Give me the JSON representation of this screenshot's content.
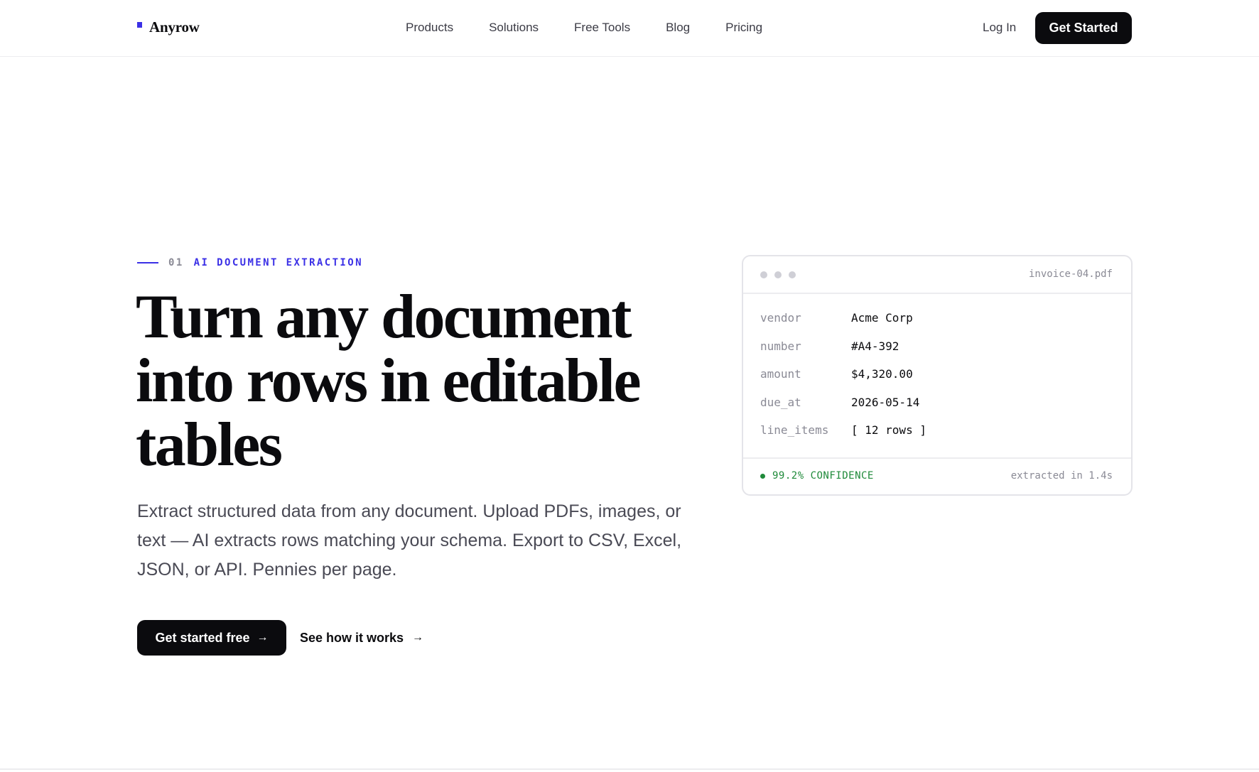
{
  "brand": {
    "name": "Anyrow",
    "accent": "#3b30e6"
  },
  "nav": {
    "links": [
      "Products",
      "Solutions",
      "Free Tools",
      "Blog",
      "Pricing"
    ],
    "login": "Log In",
    "cta": "Get Started"
  },
  "hero": {
    "eyebrow_num": "01",
    "eyebrow_label": "AI DOCUMENT EXTRACTION",
    "headline": "Turn any document into rows in editable tables",
    "subtext": "Extract structured data from any document. Upload PDFs, images, or text — AI extracts rows matching your schema. Export to CSV, Excel, JSON, or API. Pennies per page.",
    "primary_cta": "Get started free",
    "secondary_cta": "See how it works",
    "arrow": "→"
  },
  "card": {
    "filename": "invoice-04.pdf",
    "fields": [
      {
        "key": "vendor",
        "value": "Acme Corp"
      },
      {
        "key": "number",
        "value": "#A4-392"
      },
      {
        "key": "amount",
        "value": "$4,320.00"
      },
      {
        "key": "due_at",
        "value": "2026-05-14"
      },
      {
        "key": "line_items",
        "value": "[ 12 rows ]"
      }
    ],
    "confidence": "99.2% CONFIDENCE",
    "confidence_color": "#1f8a3a",
    "extracted": "extracted in 1.4s"
  }
}
